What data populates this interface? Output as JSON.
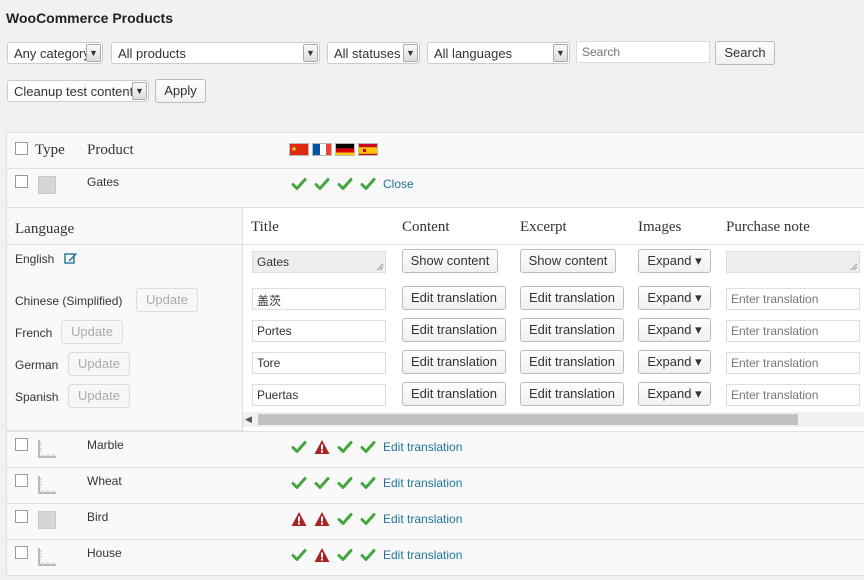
{
  "page": {
    "title": "WooCommerce Products"
  },
  "filters": {
    "category": "Any category",
    "products": "All products",
    "statuses": "All statuses",
    "languages": "All languages",
    "search_placeholder": "Search",
    "search_button": "Search"
  },
  "bulk": {
    "action": "Cleanup test content",
    "apply": "Apply"
  },
  "table": {
    "col_type": "Type",
    "col_product": "Product",
    "flags": [
      "chinese-flag-icon",
      "french-flag-icon",
      "german-flag-icon",
      "spanish-flag-icon"
    ]
  },
  "gates": {
    "name": "Gates",
    "close": "Close",
    "status": [
      "check",
      "check",
      "check",
      "check"
    ]
  },
  "expanded": {
    "col_language": "Language",
    "col_title": "Title",
    "col_content": "Content",
    "col_excerpt": "Excerpt",
    "col_images": "Images",
    "col_purchase_note": "Purchase note",
    "english": {
      "label": "English",
      "title": "Gates",
      "content": "Show content",
      "excerpt": "Show content",
      "images": "Expand ▾"
    },
    "update_label": "Update",
    "edit_translation": "Edit translation",
    "expand_label": "Expand ▾",
    "enter_translation_placeholder": "Enter translation",
    "rows": [
      {
        "lang": "Chinese (Simplified)",
        "title": "盖茨"
      },
      {
        "lang": "French",
        "title": "Portes"
      },
      {
        "lang": "German",
        "title": "Tore"
      },
      {
        "lang": "Spanish",
        "title": "Puertas"
      }
    ]
  },
  "products": [
    {
      "name": "Marble",
      "status": [
        "check",
        "warning",
        "check",
        "check"
      ],
      "action": "Edit translation"
    },
    {
      "name": "Wheat",
      "status": [
        "check",
        "check",
        "check",
        "check"
      ],
      "action": "Edit translation"
    },
    {
      "name": "Bird",
      "status": [
        "warning",
        "warning",
        "check",
        "check"
      ],
      "action": "Edit translation"
    },
    {
      "name": "House",
      "status": [
        "check",
        "warning",
        "check",
        "check"
      ],
      "action": "Edit translation"
    }
  ],
  "colors": {
    "check": "#45a53f",
    "warning": "#a62626",
    "link": "#21759b"
  }
}
